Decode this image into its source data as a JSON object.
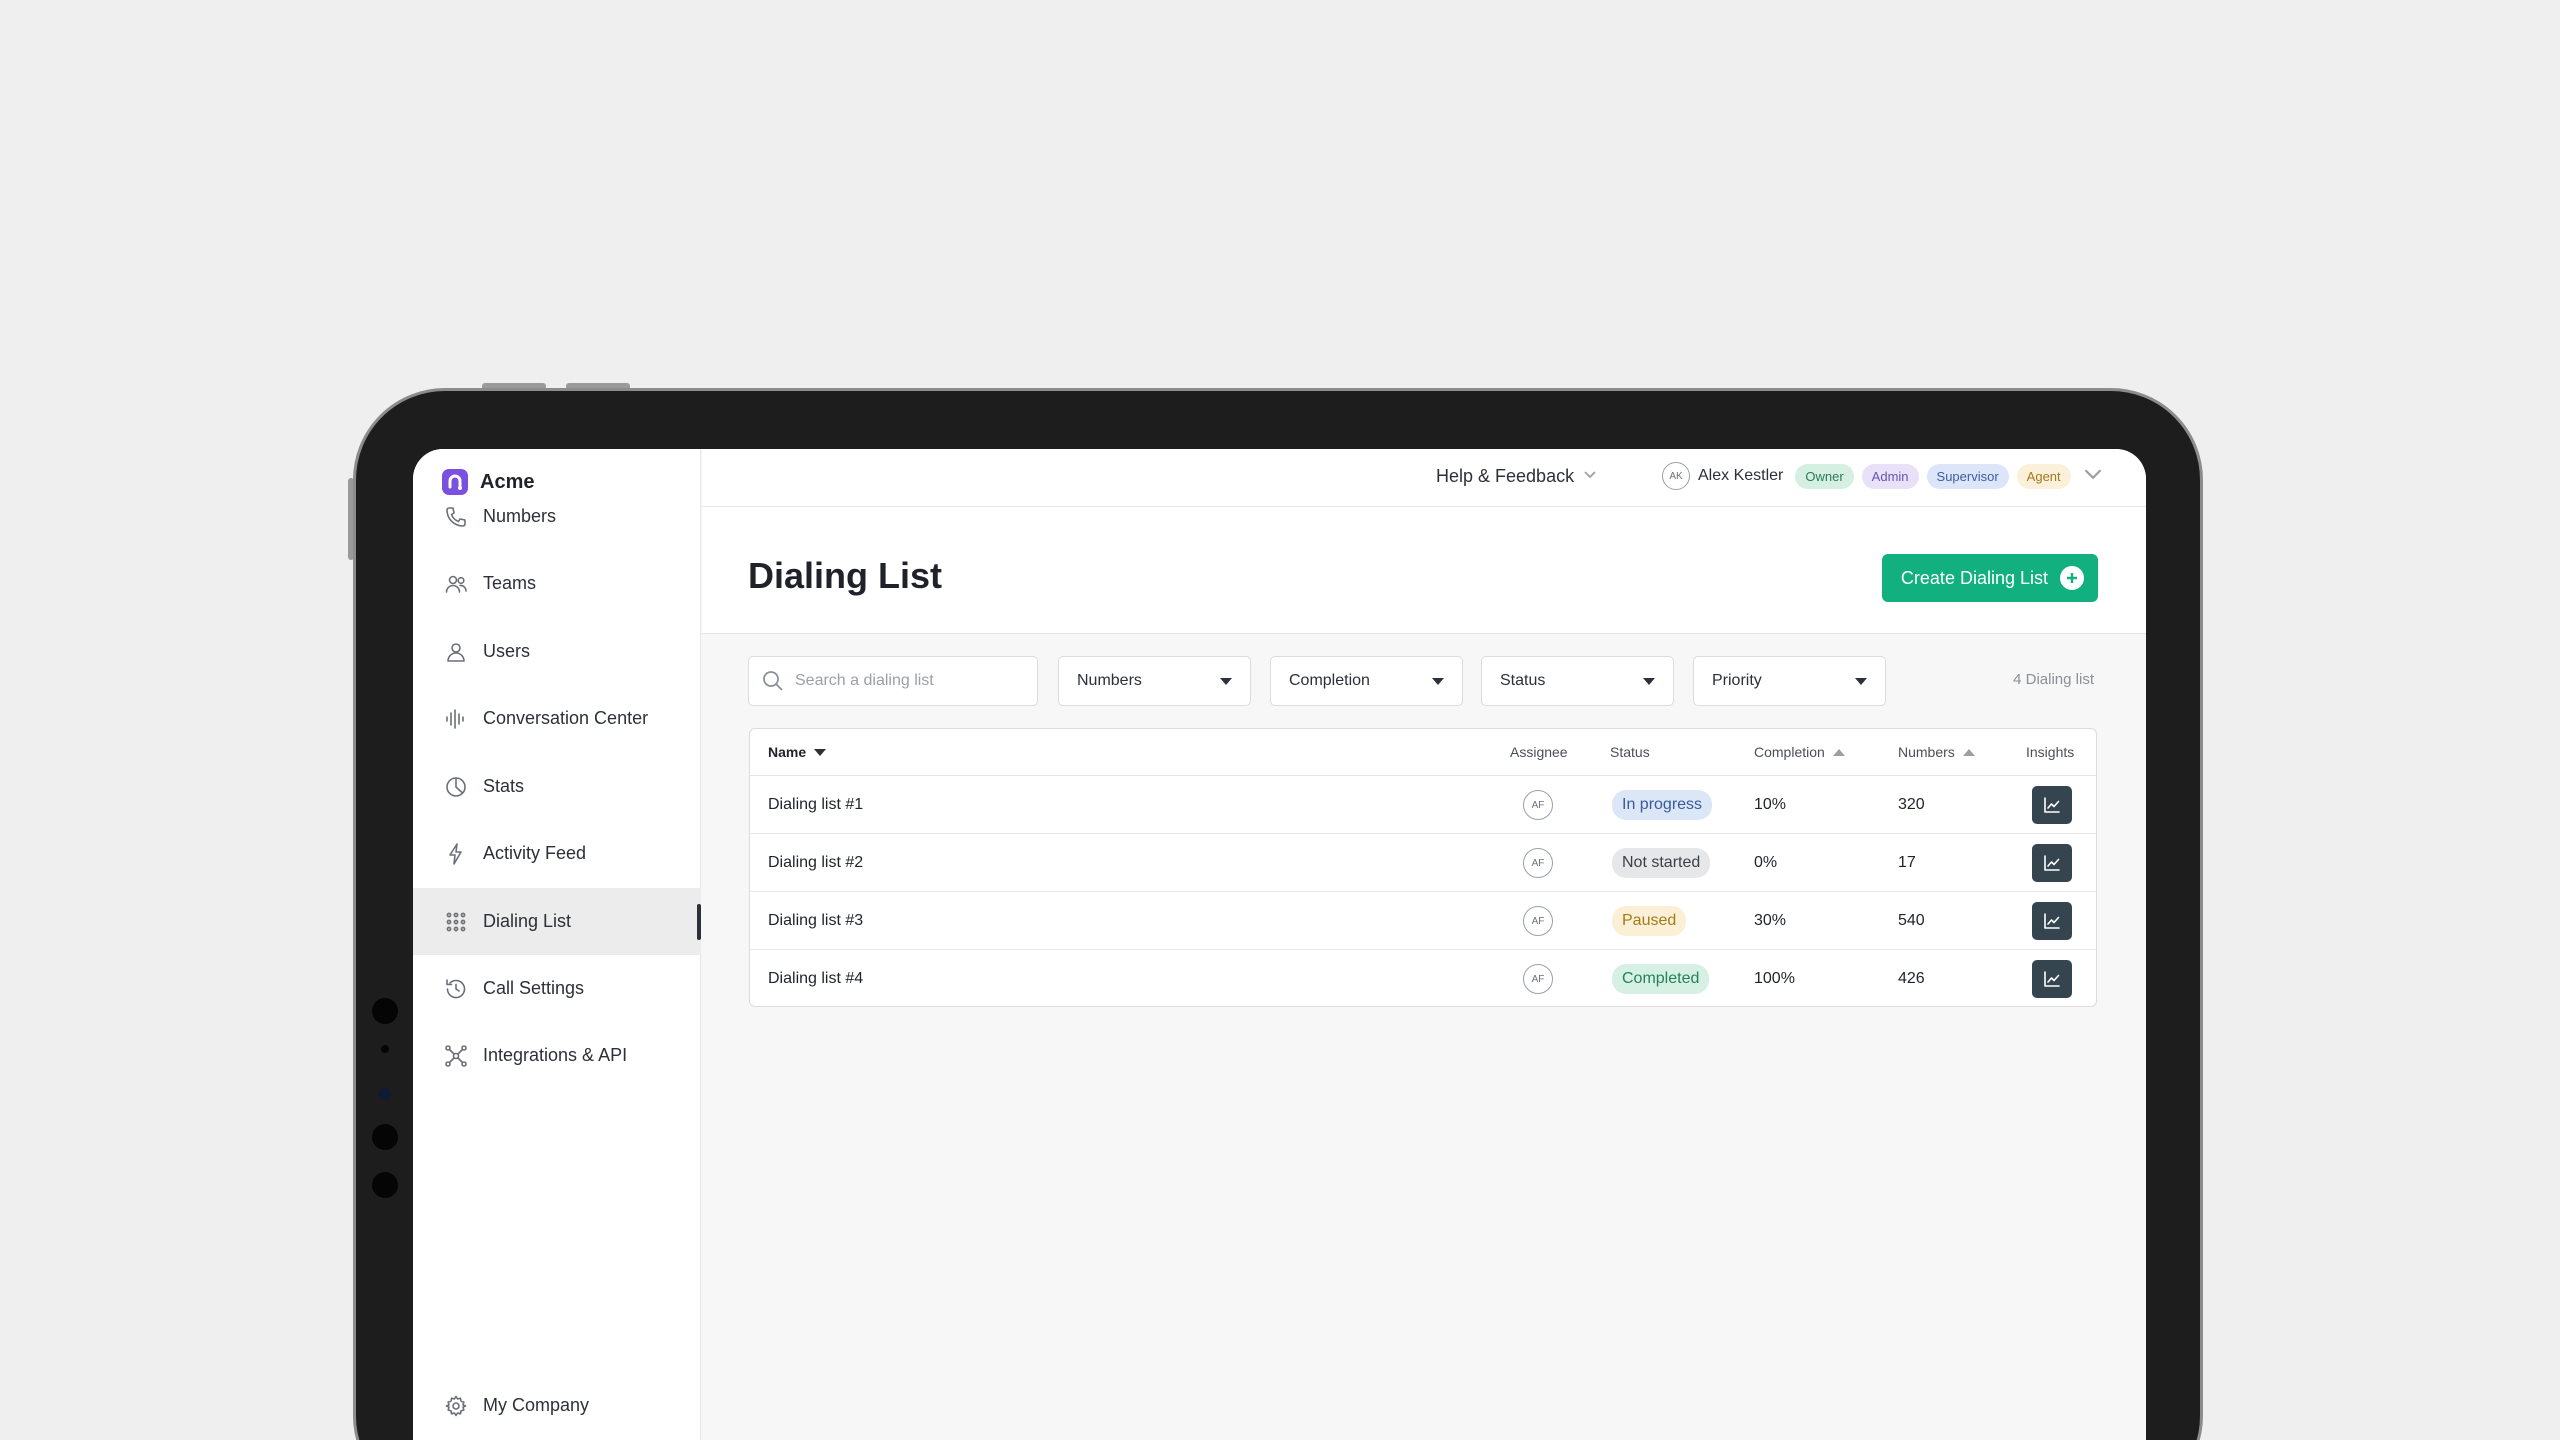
{
  "brand": {
    "name": "Acme"
  },
  "sidebar": {
    "items": [
      {
        "label": "Numbers",
        "icon": "phone-icon"
      },
      {
        "label": "Teams",
        "icon": "team-icon"
      },
      {
        "label": "Users",
        "icon": "user-icon"
      },
      {
        "label": "Conversation Center",
        "icon": "waveform-icon"
      },
      {
        "label": "Stats",
        "icon": "pie-chart-icon"
      },
      {
        "label": "Activity Feed",
        "icon": "lightning-icon"
      },
      {
        "label": "Dialing List",
        "icon": "grid-icon",
        "active": true
      },
      {
        "label": "Call Settings",
        "icon": "history-icon"
      },
      {
        "label": "Integrations & API",
        "icon": "network-icon"
      }
    ],
    "footer": {
      "label": "My Company",
      "icon": "gear-icon"
    }
  },
  "topbar": {
    "help_label": "Help & Feedback",
    "user": {
      "initials": "AK",
      "name": "Alex Kestler",
      "roles": [
        "Owner",
        "Admin",
        "Supervisor",
        "Agent"
      ]
    }
  },
  "page": {
    "title": "Dialing List",
    "create_button": "Create Dialing List"
  },
  "filters": {
    "search_placeholder": "Search a dialing list",
    "dropdowns": [
      "Numbers",
      "Completion",
      "Status",
      "Priority"
    ],
    "count_label": "4 Dialing list"
  },
  "table": {
    "columns": {
      "name": "Name",
      "assignee": "Assignee",
      "status": "Status",
      "completion": "Completion",
      "numbers": "Numbers",
      "insights": "Insights"
    },
    "rows": [
      {
        "name": "Dialing list  #1",
        "assignee": "AF",
        "status": "In progress",
        "completion": "10%",
        "numbers": "320"
      },
      {
        "name": "Dialing list  #2",
        "assignee": "AF",
        "status": "Not started",
        "completion": "0%",
        "numbers": "17"
      },
      {
        "name": "Dialing list  #3",
        "assignee": "AF",
        "status": "Paused",
        "completion": "30%",
        "numbers": "540"
      },
      {
        "name": "Dialing list  #4",
        "assignee": "AF",
        "status": "Completed",
        "completion": "100%",
        "numbers": "426"
      }
    ]
  },
  "colors": {
    "accent": "#12b07e",
    "brand": "#7b4fe0",
    "status": {
      "In progress": {
        "bg": "#dbe7f7",
        "fg": "#3a5a9a"
      },
      "Not started": {
        "bg": "#e6e7e9",
        "fg": "#3b4048"
      },
      "Paused": {
        "bg": "#fbf0d5",
        "fg": "#a57a1a"
      },
      "Completed": {
        "bg": "#d6f1e4",
        "fg": "#24825a"
      }
    }
  }
}
